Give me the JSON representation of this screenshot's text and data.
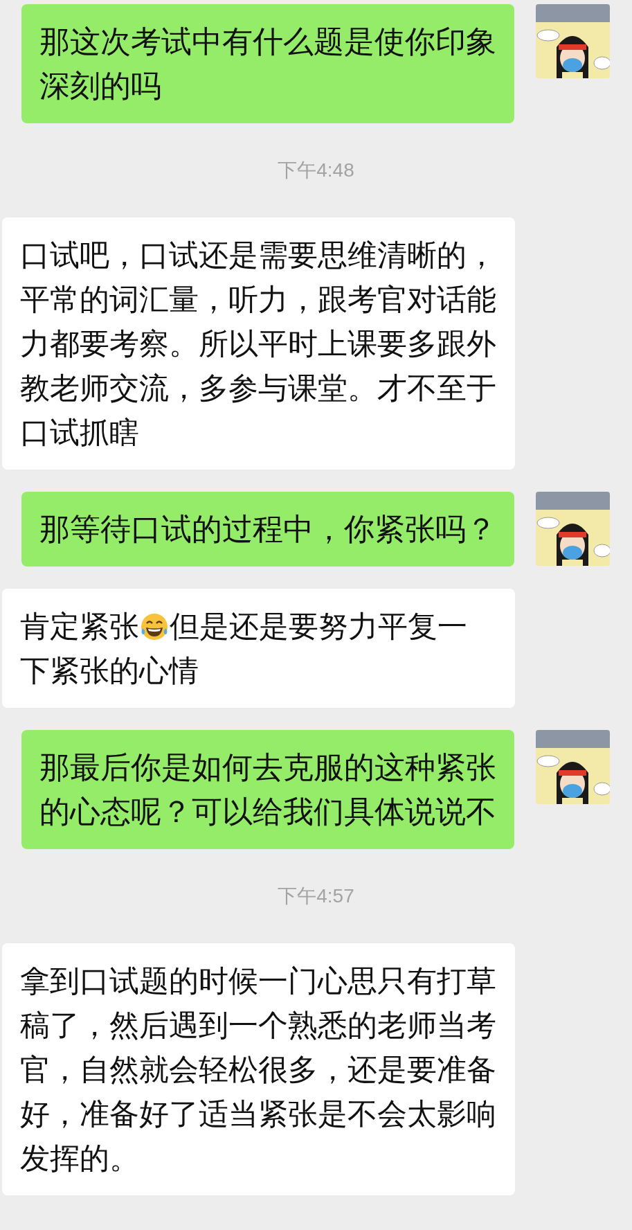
{
  "messages": [
    {
      "kind": "sent",
      "text": "那这次考试中有什么题是使你印象深刻的吗"
    },
    {
      "kind": "time",
      "text": "下午4:48"
    },
    {
      "kind": "received",
      "text": "口试吧，口试还是需要思维清晰的，平常的词汇量，听力，跟考官对话能力都要考察。所以平时上课要多跟外教老师交流，多参与课堂。才不至于口试抓瞎"
    },
    {
      "kind": "sent",
      "text": "那等待口试的过程中，你紧张吗？"
    },
    {
      "kind": "received",
      "parts": [
        {
          "kind": "text",
          "text": "肯定紧张"
        },
        {
          "kind": "emoji"
        },
        {
          "kind": "text",
          "text": "但是还是要努力平复一"
        },
        {
          "kind": "break"
        },
        {
          "kind": "text",
          "text": "下紧张的心情"
        }
      ]
    },
    {
      "kind": "sent",
      "text": "那最后你是如何去克服的这种紧张的心态呢？可以给我们具体说说不"
    },
    {
      "kind": "time",
      "text": "下午4:57"
    },
    {
      "kind": "received",
      "text": "拿到口试题的时候一门心思只有打草稿了，然后遇到一个熟悉的老师当考官，自然就会轻松很多，还是要准备好，准备好了适当紧张是不会太影响发挥的。"
    }
  ]
}
